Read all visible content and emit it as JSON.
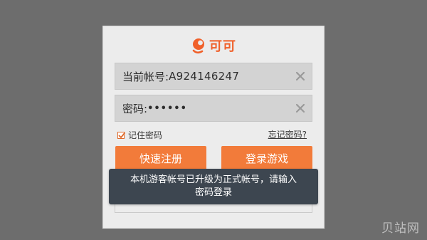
{
  "brand": {
    "logo_icon": "keke-logo-icon",
    "name": "可可",
    "color": "#f0602a"
  },
  "account_field": {
    "label": "当前帐号:",
    "value": "A924146247",
    "clear_icon": "clear-icon"
  },
  "password_field": {
    "label": "密码:",
    "value": "••••••",
    "clear_icon": "clear-icon"
  },
  "remember": {
    "checked": true,
    "label": "记住密码"
  },
  "forgot_password": "忘记密码?",
  "buttons": {
    "register": "快速注册",
    "login": "登录游戏",
    "color": "#f27b3a"
  },
  "toast": {
    "line1": "本机游客帐号已升级为正式帐号，请输入",
    "line2": "密码登录"
  },
  "watermark": "贝站网"
}
